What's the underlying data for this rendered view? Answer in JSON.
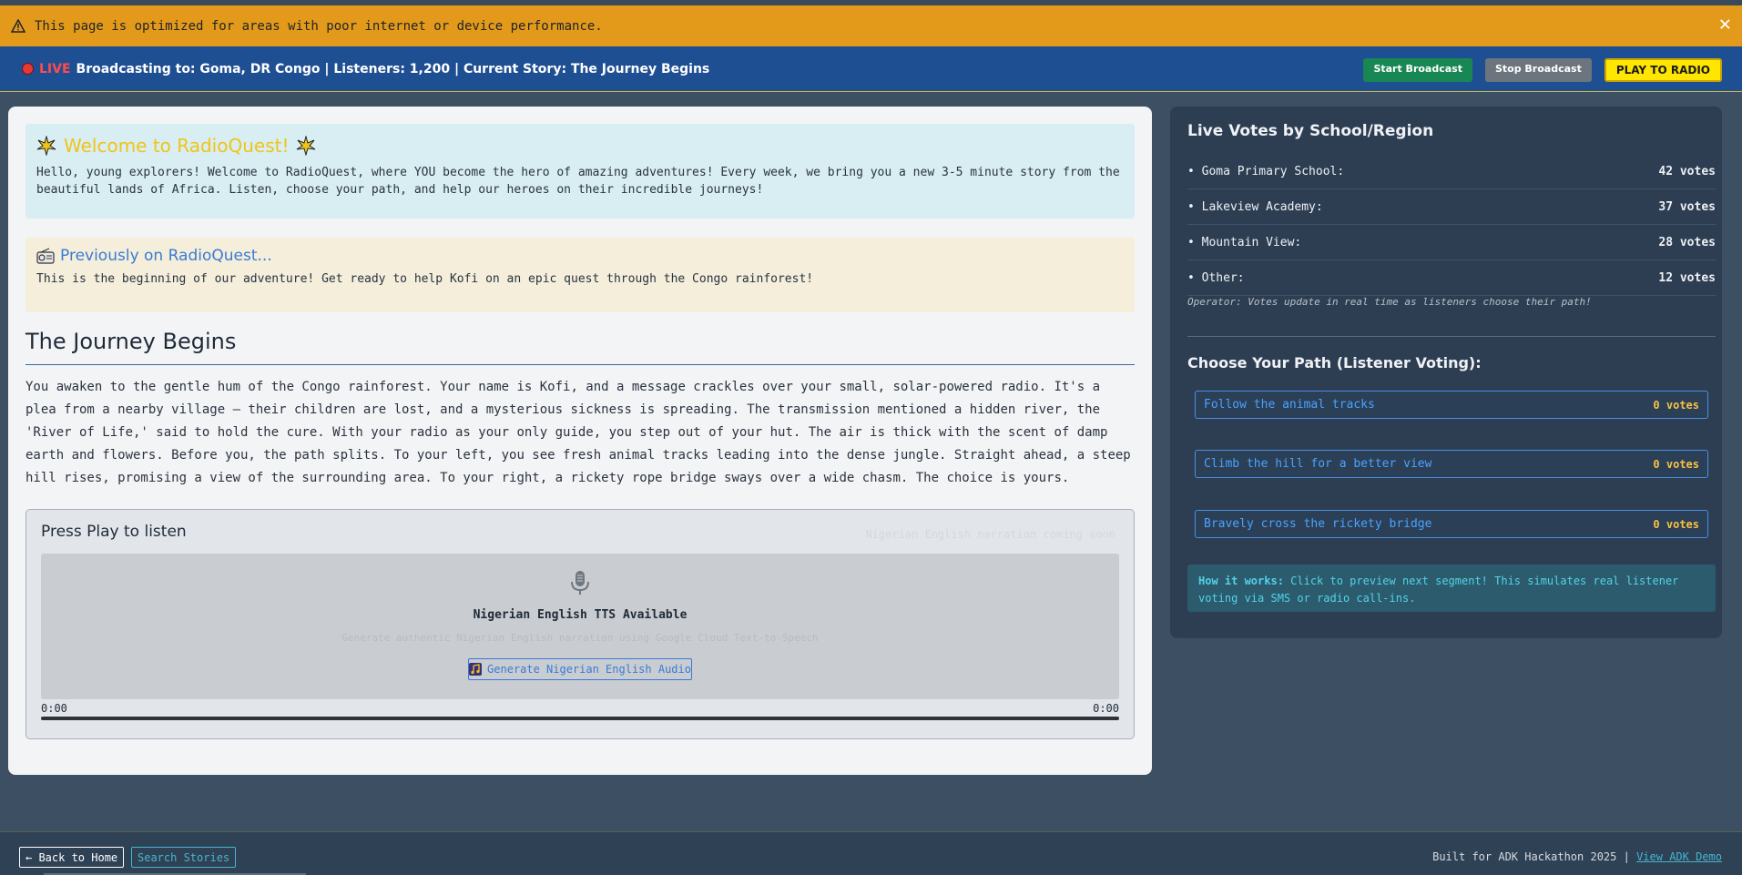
{
  "banner": {
    "message": "This page is optimized for areas with poor internet or device performance.",
    "close_symbol": "✕"
  },
  "live": {
    "word": "LIVE",
    "status": "Broadcasting to: Goma, DR Congo | Listeners: 1,200 | Current Story: The Journey Begins",
    "start_label": "Start Broadcast",
    "stop_label": "Stop Broadcast",
    "play_label": "PLAY TO RADIO"
  },
  "welcome": {
    "title": "Welcome to RadioQuest!",
    "text": "Hello, young explorers! Welcome to RadioQuest, where YOU become the hero of amazing adventures! Every week, we bring you a new 3-5 minute story from the beautiful lands of Africa. Listen, choose your path, and help our heroes on their incredible journeys!"
  },
  "previously": {
    "title": "Previously on RadioQuest...",
    "text": "This is the beginning of our adventure! Get ready to help Kofi on an epic quest through the Congo rainforest!"
  },
  "story": {
    "title": "The Journey Begins",
    "text": "You awaken to the gentle hum of the Congo rainforest. Your name is Kofi, and a message crackles over your small, solar-powered radio. It's a plea from a nearby village — their children are lost, and a mysterious sickness is spreading. The transmission mentioned a hidden river, the 'River of Life,' said to hold the cure. With your radio as your only guide, you step out of your hut. The air is thick with the scent of damp earth and flowers. Before you, the path splits. To your left, you see fresh animal tracks leading into the dense jungle. Straight ahead, a steep hill rises, promising a view of the surrounding area. To your right, a rickety rope bridge sways over a wide chasm. The choice is yours."
  },
  "player": {
    "title": "Press Play to listen",
    "faint_note": "Nigerian English narration coming soon",
    "tts_title": "Nigerian English TTS Available",
    "tts_desc": "Generate authentic Nigerian English narration using Google Cloud Text-to-Speech",
    "generate_label": "Generate Nigerian English Audio",
    "time_start": "0:00",
    "time_end": "0:00",
    "progress": 0
  },
  "votes": {
    "title": "Live Votes by School/Region",
    "rows": [
      {
        "name": "• Goma Primary School:",
        "count": "42 votes"
      },
      {
        "name": "• Lakeview Academy:",
        "count": "37 votes"
      },
      {
        "name": "• Mountain View:",
        "count": "28 votes"
      },
      {
        "name": "• Other:",
        "count": "12 votes"
      }
    ],
    "operator_note": "Operator: Votes update in real time as listeners choose their path!"
  },
  "choices": {
    "title": "Choose Your Path (Listener Voting):",
    "items": [
      {
        "label": "Follow the animal tracks",
        "votes": "0 votes"
      },
      {
        "label": "Climb the hill for a better view",
        "votes": "0 votes"
      },
      {
        "label": "Bravely cross the rickety bridge",
        "votes": "0 votes"
      }
    ],
    "how_label": "How it works:",
    "how_text": "Click to preview next segment! This simulates real listener voting via SMS or radio call-ins."
  },
  "footer": {
    "back_label": "← Back to Home",
    "search_label": "Search Stories",
    "built_text": "Built for ADK Hackathon 2025 |",
    "demo_link": "View ADK Demo"
  }
}
